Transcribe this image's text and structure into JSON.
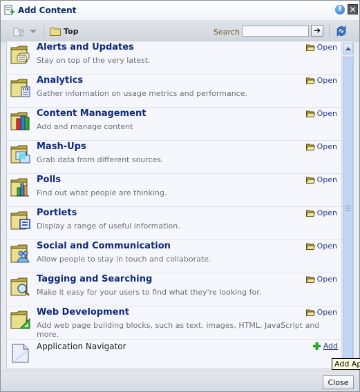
{
  "dialog": {
    "title": "Add Content",
    "help_label": "?",
    "close_label": "✕"
  },
  "toolbar": {
    "location": "Top",
    "search_label": "Search",
    "search_value": "",
    "search_placeholder": "",
    "go_label": "➔"
  },
  "items": [
    {
      "name": "Alerts and Updates",
      "desc": "Stay on top of the very latest.",
      "action": "Open",
      "icon": "alerts-folder-icon"
    },
    {
      "name": "Analytics",
      "desc": "Gather information on usage metrics and performance.",
      "action": "Open",
      "icon": "analytics-folder-icon"
    },
    {
      "name": "Content Management",
      "desc": "Add and manage content",
      "action": "Open",
      "icon": "content-management-folder-icon"
    },
    {
      "name": "Mash-Ups",
      "desc": "Grab data from different sources.",
      "action": "Open",
      "icon": "mashups-folder-icon"
    },
    {
      "name": "Polls",
      "desc": "Find out what people are thinking.",
      "action": "Open",
      "icon": "polls-folder-icon"
    },
    {
      "name": "Portlets",
      "desc": "Display a range of useful information.",
      "action": "Open",
      "icon": "portlets-folder-icon"
    },
    {
      "name": "Social and Communication",
      "desc": "Allow people to stay in touch and collaborate.",
      "action": "Open",
      "icon": "social-folder-icon"
    },
    {
      "name": "Tagging and Searching",
      "desc": "Make it easy for your users to find what they're looking for.",
      "action": "Open",
      "icon": "tagging-folder-icon"
    },
    {
      "name": "Web Development",
      "desc": "Add web page building blocks, such as text, images, HTML, JavaScript and more.",
      "action": "Open",
      "icon": "webdev-folder-icon"
    }
  ],
  "app_item": {
    "name": "Application Navigator",
    "action": "Add",
    "icon": "document-icon"
  },
  "tooltip": "Add App",
  "footer": {
    "close_label": "Close"
  }
}
